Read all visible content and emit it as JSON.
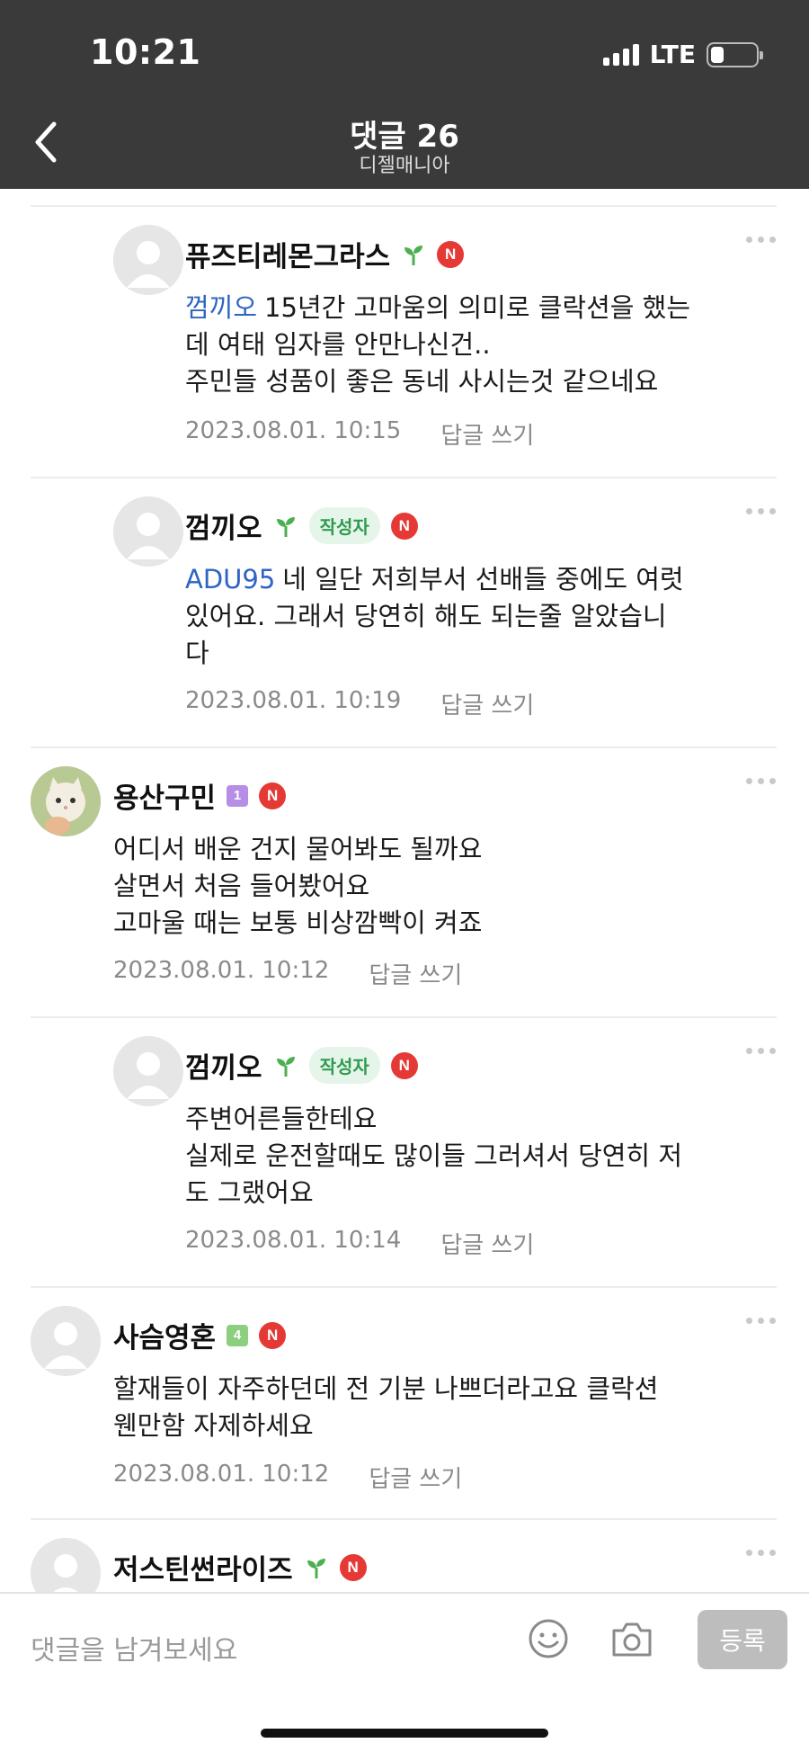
{
  "status_bar": {
    "time": "10:21",
    "network": "LTE",
    "battery_level": 0.3
  },
  "header": {
    "title": "댓글 26",
    "subtitle": "디젤매니아"
  },
  "comments": [
    {
      "nickname": "퓨즈티레몬그라스",
      "is_reply": true,
      "mention": "껌끼오",
      "lines": [
        "15년간 고마움의 의미로 클락션을 했는",
        "데 여태 임자를 안만나신건..",
        "주민들 성품이 좋은 동네 사시는것 같으네요"
      ],
      "date": "2023.08.01. 10:15",
      "reply_label": "답글 쓰기"
    },
    {
      "nickname": "껌끼오",
      "is_reply": true,
      "author_tag": "작성자",
      "mention": "ADU95",
      "lines": [
        "네 일단 저희부서 선배들 중에도 여럿",
        "있어요. 그래서 당연히 해도 되는줄 알았습니",
        "다"
      ],
      "date": "2023.08.01. 10:19",
      "reply_label": "답글 쓰기"
    },
    {
      "nickname": "용산구민",
      "is_reply": false,
      "level": "1",
      "lines": [
        "어디서 배운 건지 물어봐도 될까요",
        "살면서 처음 들어봤어요",
        "고마울 때는 보통 비상깜빡이 켜죠"
      ],
      "date": "2023.08.01. 10:12",
      "reply_label": "답글 쓰기"
    },
    {
      "nickname": "껌끼오",
      "is_reply": true,
      "author_tag": "작성자",
      "lines": [
        "주변어른들한테요",
        "실제로 운전할때도 많이들 그러셔서 당연히 저",
        "도 그랬어요"
      ],
      "date": "2023.08.01. 10:14",
      "reply_label": "답글 쓰기"
    },
    {
      "nickname": "사슴영혼",
      "is_reply": false,
      "level": "4",
      "lines": [
        "할재들이 자주하던데 전 기분 나쁘더라고요 클락션",
        "웬만함 자제하세요"
      ],
      "date": "2023.08.01. 10:12",
      "reply_label": "답글 쓰기"
    },
    {
      "nickname": "저스틴썬라이즈",
      "is_reply": false
    }
  ],
  "badges": {
    "new": "N"
  },
  "input_bar": {
    "placeholder": "댓글을 남겨보세요",
    "submit_label": "등록"
  },
  "icons": {
    "back": "chevron-left-icon",
    "more": "more-dots-icon",
    "emoji": "smiley-icon",
    "camera": "camera-icon",
    "sprout": "sprout-icon"
  },
  "colors": {
    "header_bg": "#3a3a3a",
    "mention": "#2f63c4",
    "new_badge": "#e53935",
    "author_tag_text": "#2e9b4f"
  }
}
